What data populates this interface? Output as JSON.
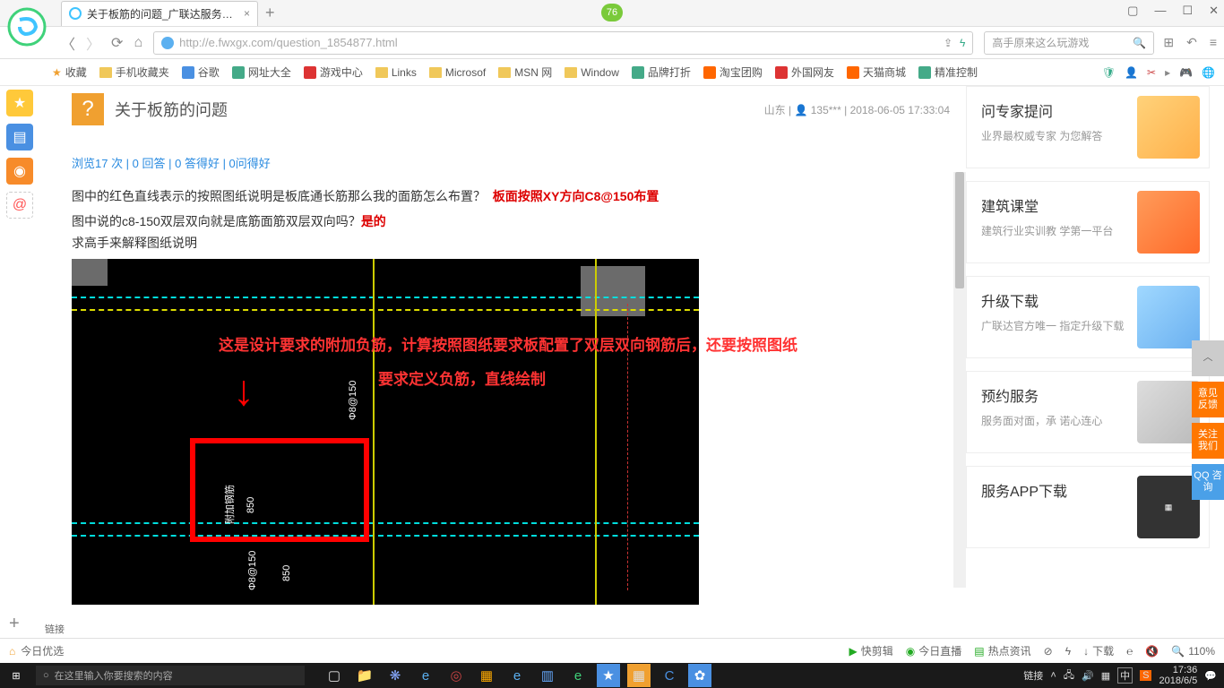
{
  "browser": {
    "tab_title": "关于板筋的问题_广联达服务新干",
    "url": "http://e.fwxgx.com/question_1854877.html",
    "badge": "76",
    "search_placeholder": "高手原来这么玩游戏"
  },
  "bookmarks": [
    "收藏",
    "手机收藏夹",
    "谷歌",
    "网址大全",
    "游戏中心",
    "Links",
    "Microsof",
    "MSN 网",
    "Window",
    "品牌打折",
    "淘宝团购",
    "外国网友",
    "天猫商城",
    "精准控制"
  ],
  "question": {
    "icon": "?",
    "title": "关于板筋的问题",
    "meta_region": "山东",
    "meta_user": "135***",
    "meta_time": "2018-06-05 17:33:04",
    "stats": "浏览17 次 | 0 回答 | 0 答得好 | 0问得好",
    "line1_a": "图中的红色直线表示的按照图纸说明是板底通长筋那么我的面筋怎么布置？",
    "line1_red": "板面按照XY方向C8@150布置",
    "line2_a": "图中说的c8-150双层双向就是底筋面筋双层双向吗？",
    "line2_red": "是的",
    "line3": "求高手来解释图纸说明"
  },
  "cad": {
    "text1": "这是设计要求的附加负筋，计算按照图纸要求板配置了双层双向钢筋后，还要按照图纸",
    "text2": "要求定义负筋，直线绘制",
    "label1": "Φ8@150",
    "dim850a": "850",
    "dim850b": "850",
    "label2": "Φ8@150",
    "boxlabel": "附加钢筋"
  },
  "sidecards": [
    {
      "title": "问专家提问",
      "desc": "业界最权威专家\n为您解答"
    },
    {
      "title": "建筑课堂",
      "desc": "建筑行业实训教\n学第一平台"
    },
    {
      "title": "升级下载",
      "desc": "广联达官方唯一\n指定升级下载"
    },
    {
      "title": "预约服务",
      "desc": "服务面对面，承\n诺心连心"
    },
    {
      "title": "服务APP下载",
      "desc": ""
    }
  ],
  "floatbtns": [
    "意见\n反馈",
    "关注\n我们",
    "QQ\n咨询"
  ],
  "statusbar": {
    "left": "今日优选",
    "items": [
      "快剪辑",
      "今日直播",
      "热点资讯",
      "下载"
    ],
    "zoom": "110%",
    "link_label": "链接"
  },
  "taskbar": {
    "search": "在这里输入你要搜索的内容",
    "time": "17:36",
    "date": "2018/6/5",
    "ime": "中"
  }
}
